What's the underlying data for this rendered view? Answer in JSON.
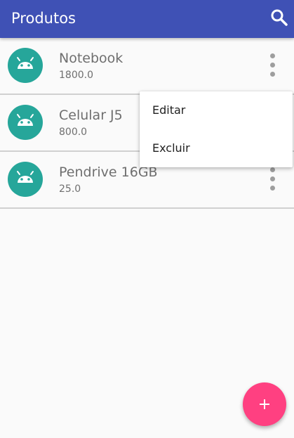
{
  "app_bar": {
    "title": "Produtos",
    "background_color": "#3f51b5",
    "search_icon": "search-icon"
  },
  "products": [
    {
      "name": "Notebook",
      "price": "1800.0",
      "icon": "android-icon"
    },
    {
      "name": "Celular J5",
      "price": "800.0",
      "icon": "android-icon"
    },
    {
      "name": "Pendrive 16GB",
      "price": "25.0",
      "icon": "android-icon"
    }
  ],
  "context_menu": {
    "items": [
      "Editar",
      "Excluir"
    ]
  },
  "fab": {
    "icon": "plus-icon",
    "color": "#ff4081"
  },
  "avatar_color": "#26a69a"
}
